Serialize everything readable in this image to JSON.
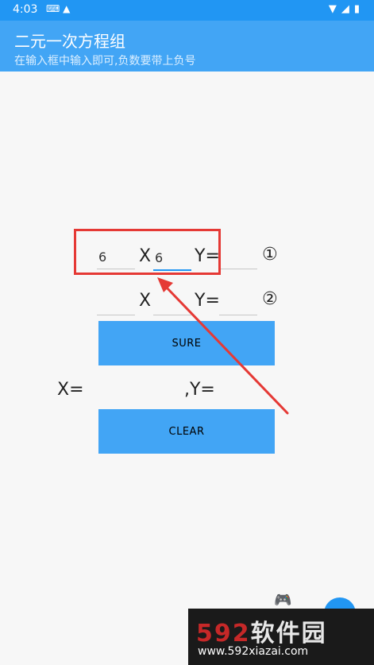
{
  "status_bar": {
    "time": "4:03",
    "left_icons": [
      "keyboard-icon",
      "warning-icon"
    ],
    "right_icons": [
      "wifi-icon",
      "signal-icon",
      "battery-icon"
    ]
  },
  "app_bar": {
    "title": "二元一次方程组",
    "subtitle": "在输入框中输入即可,负数要带上负号"
  },
  "equation1": {
    "a_value": "6",
    "x_label": "X",
    "b_value": "6",
    "y_label": "Y=",
    "c_value": "",
    "marker": "①"
  },
  "equation2": {
    "a_value": "",
    "x_label": "X",
    "b_value": "",
    "y_label": "Y=",
    "c_value": "",
    "marker": "②"
  },
  "buttons": {
    "sure": "SURE",
    "clear": "CLEAR"
  },
  "result": {
    "x_label": "X=",
    "x_value": "",
    "y_label": ",Y=",
    "y_value": ""
  },
  "watermark": {
    "logo_number": "592",
    "logo_text": "软件园",
    "url": "www.592xiazai.com"
  },
  "colors": {
    "status_bar": "#2196f3",
    "app_bar": "#42a5f5",
    "button": "#42a5f5",
    "annotation": "#e53935"
  }
}
